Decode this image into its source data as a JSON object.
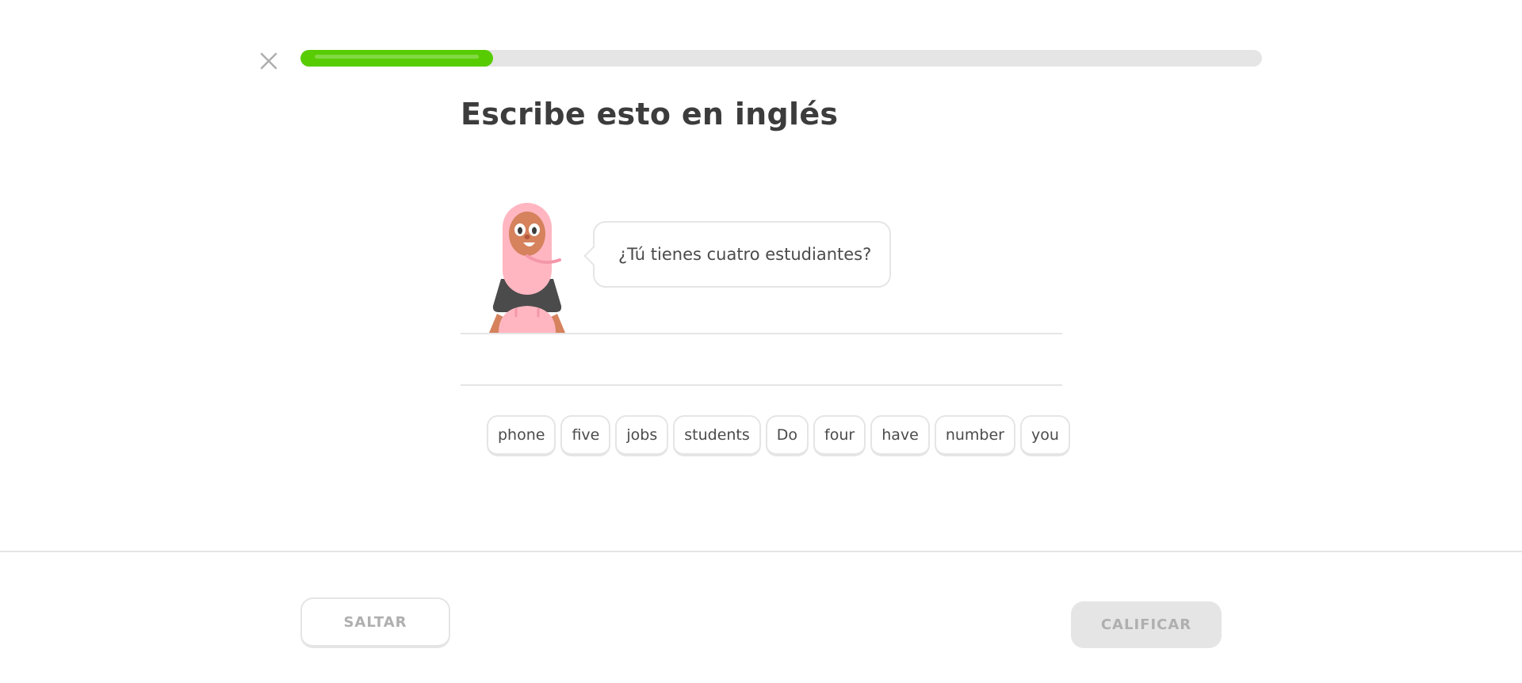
{
  "header": {
    "close_icon": "close-icon",
    "progress": 0.2,
    "progress_color": "#58cc02",
    "track_color": "#e5e5e5"
  },
  "challenge": {
    "title": "Escribe esto en inglés",
    "prompt_sentence": "¿Tú tienes cuatro estudiantes?",
    "character_icon": "character-illustration"
  },
  "word_bank": [
    {
      "label": "phone"
    },
    {
      "label": "five"
    },
    {
      "label": "jobs"
    },
    {
      "label": "students"
    },
    {
      "label": "Do"
    },
    {
      "label": "four"
    },
    {
      "label": "have"
    },
    {
      "label": "number"
    },
    {
      "label": "you"
    }
  ],
  "footer": {
    "skip_label": "SALTAR",
    "check_label": "CALIFICAR"
  }
}
